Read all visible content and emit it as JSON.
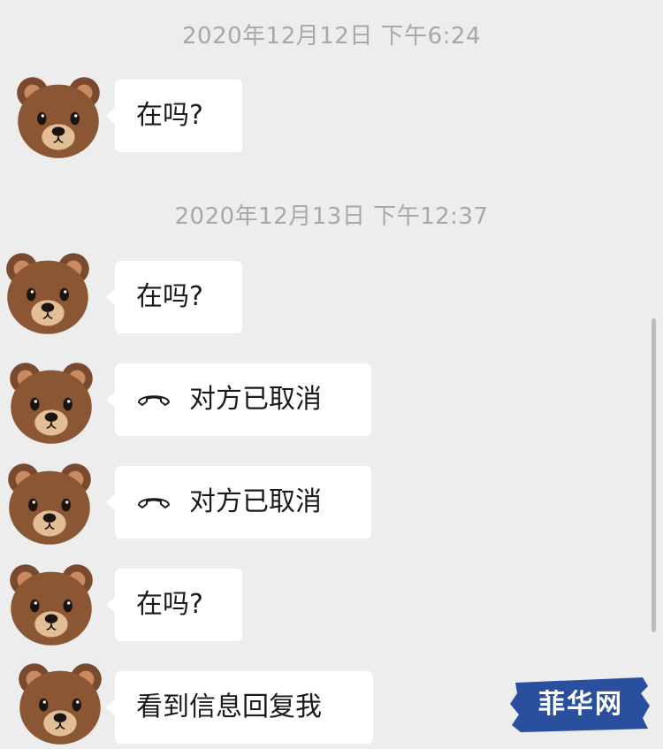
{
  "chat": {
    "timestamps": [
      "2020年12月12日 下午6:24",
      "2020年12月13日 下午12:37"
    ],
    "messages": [
      {
        "text": "在吗?"
      },
      {
        "text": "在吗?"
      },
      {
        "text": "对方已取消",
        "icon": "phone-hangup-icon"
      },
      {
        "text": "对方已取消",
        "icon": "phone-hangup-icon"
      },
      {
        "text": "在吗?"
      },
      {
        "text": "看到信息回复我"
      }
    ],
    "avatar_icon": "bear-face-avatar"
  },
  "watermark": {
    "text": "菲华网",
    "color": "#2a4f9e"
  },
  "colors": {
    "background": "#ededed",
    "bubble": "#ffffff",
    "timestamp": "#a8a8a8",
    "text": "#1a1a1a"
  }
}
